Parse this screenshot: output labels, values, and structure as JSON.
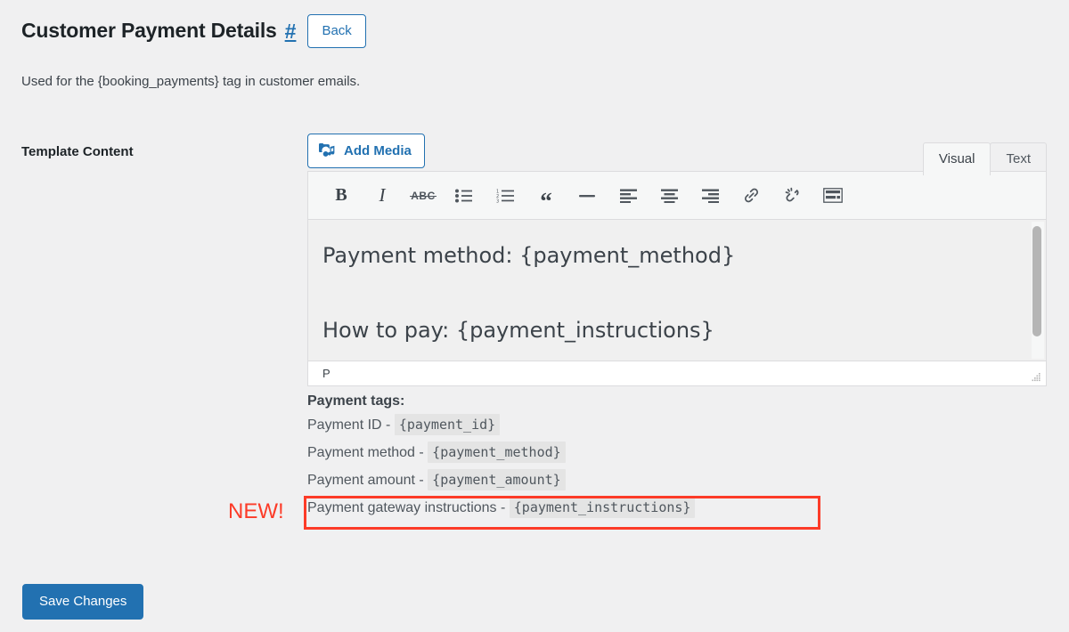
{
  "header": {
    "title": "Customer Payment Details",
    "anchor": "#",
    "back_label": "Back",
    "subtitle": "Used for the {booking_payments} tag in customer emails."
  },
  "form": {
    "field_label": "Template Content"
  },
  "editor": {
    "add_media_label": "Add Media",
    "tabs": [
      {
        "label": "Visual",
        "active": true
      },
      {
        "label": "Text",
        "active": false
      }
    ],
    "toolbar": [
      {
        "name": "bold-icon",
        "glyph": "B"
      },
      {
        "name": "italic-icon",
        "glyph": "I"
      },
      {
        "name": "strikethrough-icon",
        "glyph": "ABC"
      },
      {
        "name": "bulleted-list-icon",
        "glyph": ""
      },
      {
        "name": "numbered-list-icon",
        "glyph": ""
      },
      {
        "name": "blockquote-icon",
        "glyph": "“"
      },
      {
        "name": "horizontal-rule-icon",
        "glyph": ""
      },
      {
        "name": "align-left-icon",
        "glyph": ""
      },
      {
        "name": "align-center-icon",
        "glyph": ""
      },
      {
        "name": "align-right-icon",
        "glyph": ""
      },
      {
        "name": "insert-link-icon",
        "glyph": ""
      },
      {
        "name": "remove-link-icon",
        "glyph": ""
      },
      {
        "name": "toolbar-toggle-icon",
        "glyph": ""
      }
    ],
    "content": {
      "line1": "Payment method: {payment_method}",
      "line2": "How to pay: {payment_instructions}"
    },
    "status_path": "P"
  },
  "tags": {
    "title": "Payment tags:",
    "rows": [
      {
        "label": "Payment ID - ",
        "tag": "{payment_id}"
      },
      {
        "label": "Payment method - ",
        "tag": "{payment_method}"
      },
      {
        "label": "Payment amount - ",
        "tag": "{payment_amount}"
      },
      {
        "label": "Payment gateway instructions - ",
        "tag": "{payment_instructions}"
      }
    ]
  },
  "annotation": {
    "new_label": "NEW!",
    "color": "#fc3b28"
  },
  "footer": {
    "save_label": "Save Changes"
  },
  "colors": {
    "accent": "#2271b1",
    "page_bg": "#f0f0f1",
    "text": "#3c434a",
    "heading": "#1d2327"
  }
}
